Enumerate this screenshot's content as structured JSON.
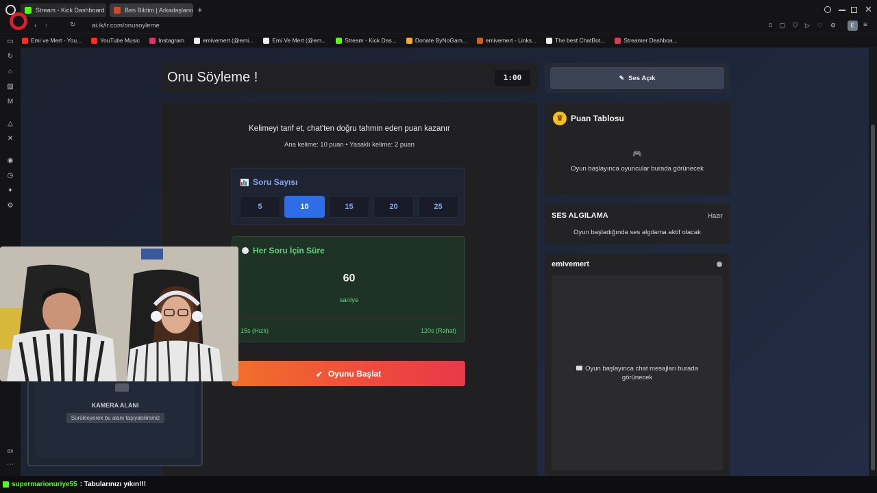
{
  "browser": {
    "tabs": [
      {
        "label": "Stream - Kick Dashboard",
        "state": "active"
      },
      {
        "label": "Ben Bildim | Arkadaşlarınız",
        "state": "inactive"
      }
    ],
    "url": "onusoyleme",
    "url_partial": "ai.ik/ir.com/onusoyleme",
    "bookmarks": [
      {
        "label": "Emi ve Mert - You...",
        "color": "#ff2a2a"
      },
      {
        "label": "YouTube Music",
        "color": "#ff2a2a"
      },
      {
        "label": "Instagram",
        "color": "#e1306c"
      },
      {
        "label": "emivemert (@emi...",
        "color": "#eeeeee"
      },
      {
        "label": "Emi Ve Mert (@em...",
        "color": "#eeeeee"
      },
      {
        "label": "Stream - Kick Das...",
        "color": "#53fc18"
      },
      {
        "label": "Donate ByNoGam...",
        "color": "#f0b020"
      },
      {
        "label": "emivemert - Links...",
        "color": "#d06020"
      },
      {
        "label": "The best ChatBot...",
        "color": "#eeeeee"
      },
      {
        "label": "Streamer Dashboa...",
        "color": "#e03a5a"
      }
    ],
    "profile_initial": "E"
  },
  "game": {
    "title": "Onu Söyleme !",
    "timer": "1:00",
    "description": "Kelimeyi tarif et, chat'ten doğru tahmin eden puan kazanır",
    "subdescription": "Ana kelime: 10 puan • Yasaklı kelime: 2 puan",
    "question_count": {
      "label": "Soru Sayısı",
      "icon": "bar-chart-icon",
      "options": [
        "5",
        "10",
        "15",
        "20",
        "25"
      ],
      "selected": "10"
    },
    "time_per_question": {
      "label": "Her Soru İçin Süre",
      "icon": "stopwatch-icon",
      "value": "60",
      "unit": "saniye",
      "min_label": "15s (Hızlı)",
      "max_label": "120s (Rahat)"
    },
    "start_button": "Oyunu Başlat"
  },
  "sidebar": {
    "sound_button": "Ses Açık",
    "scoreboard": {
      "title": "Puan Tablosu",
      "empty_icon": "🎮",
      "empty_text": "Oyun başlayınca oyuncular burada görünecek"
    },
    "audio_detection": {
      "title": "SES ALGILAMA",
      "status": "Hazır",
      "description": "Oyun başladığında ses algılama aktif olacak"
    },
    "chat": {
      "username": "emivemert",
      "empty_text": "Oyun başlayınca chat mesajları burada görünecek"
    }
  },
  "camera": {
    "title": "KAMERA ALANI",
    "hint": "Sürükleyerek bu alanı taşıyabilirsiniz"
  },
  "stream_chat": {
    "username": "supermarionuriye55",
    "message": ": Tabularınızı yıkın!!!"
  },
  "colors": {
    "accent_blue": "#2f6de8",
    "accent_green": "#5fd47c",
    "start_gradient_from": "#f2702a",
    "start_gradient_to": "#e8384a",
    "kick_green": "#53fc18"
  }
}
